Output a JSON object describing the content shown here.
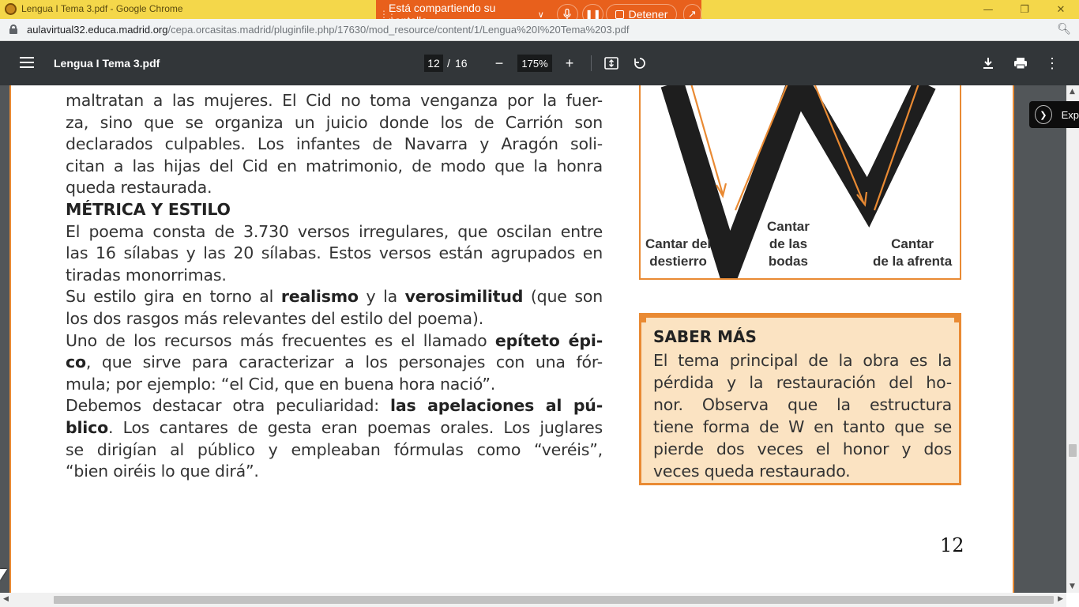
{
  "browser": {
    "window_title": "Lengua I Tema 3.pdf - Google Chrome",
    "url_host": "aulavirtual32.educa.madrid.org",
    "url_path": "/cepa.orcasitas.madrid/pluginfile.php/17630/mod_resource/content/1/Lengua%20I%20Tema%203.pdf"
  },
  "sharing": {
    "message": "Está compartiendo su pantalla",
    "stop_label": "Detener"
  },
  "pdf_toolbar": {
    "title": "Lengua I Tema 3.pdf",
    "current_page": "12",
    "page_separator": "/",
    "total_pages": "16",
    "zoom": "175%"
  },
  "document": {
    "paragraph1_lines": [
      "maltratan a las mujeres. El Cid no toma venganza por la fuer-",
      "za, sino que se organiza un juicio donde los de Carrión son",
      "declarados culpables. Los infantes de Navarra y Aragón soli-",
      "citan a las hijas del Cid en matrimonio, de modo que la honra",
      "queda restaurada."
    ],
    "heading": "MÉTRICA Y ESTILO",
    "paragraph2_lines": [
      "El poema consta de 3.730 versos irregulares, que oscilan entre",
      "las 16 sílabas y las 20 sílabas. Estos versos están agrupados en",
      "tiradas monorrimas."
    ],
    "p3": {
      "line1_a": "Su estilo gira en torno al ",
      "line1_b": "realismo",
      "line1_c": " y la ",
      "line1_d": "verosimilitud",
      "line1_e": " (que son",
      "line2": "los dos rasgos más relevantes del estilo del poema)."
    },
    "p4": {
      "line1_a": "Uno de los recursos más frecuentes es el llamado ",
      "line1_b": "epíteto épi-",
      "line2_a": "co",
      "line2_b": ", que sirve para caracterizar a los personajes con una fór-",
      "line3": "mula; por ejemplo: “el Cid, que en buena hora nació”."
    },
    "p5": {
      "line1_a": "Debemos destacar otra peculiaridad: ",
      "line1_b": "las apelaciones al pú-",
      "line2_a": "blico",
      "line2_b": ". Los cantares de gesta eran poemas orales. Los juglares",
      "line3": "se dirigían al público y empleaban fórmulas como “veréis”,",
      "line4": "“bien oiréis lo que dirá”."
    },
    "diagram_labels": {
      "left": [
        "Cantar del",
        "destierro"
      ],
      "middle": [
        "Cantar",
        "de las",
        "bodas"
      ],
      "right": [
        "Cantar",
        "de la afrenta"
      ]
    },
    "saber_mas": {
      "title": "SABER MÁS",
      "lines": [
        "El tema principal de la obra es la",
        "pérdida y la restauración del ho-",
        "nor. Observa que la estructura",
        "tiene forma de W en tanto que se",
        "pierde dos veces el honor y dos",
        "veces queda restaurado."
      ]
    },
    "page_number": "12"
  },
  "side_chip": {
    "label": "Exp"
  },
  "colors": {
    "accent_orange": "#e98a33",
    "share_bar": "#e8601c",
    "title_bar": "#f4d74a",
    "pdf_toolbar": "#323639"
  }
}
